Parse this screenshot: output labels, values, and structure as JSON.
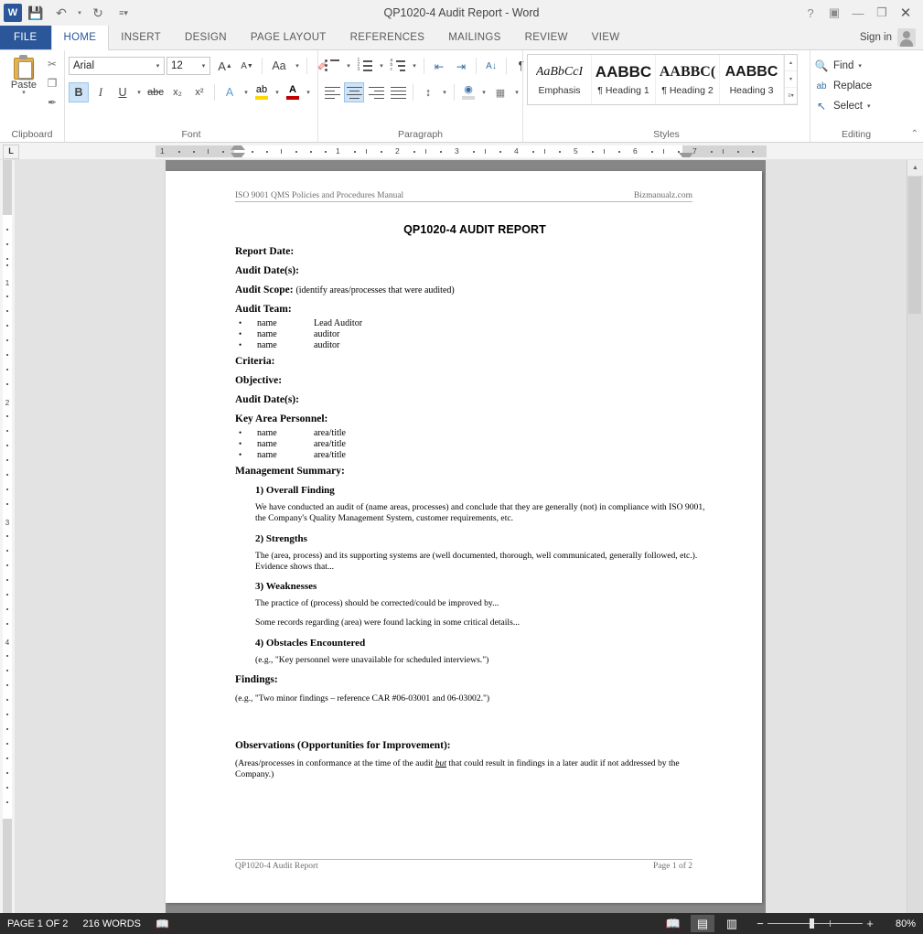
{
  "window": {
    "title": "QP1020-4 Audit Report - Word",
    "app_logo": "W",
    "quick_access": [
      {
        "name": "save-icon",
        "glyph": "💾"
      },
      {
        "name": "undo-icon",
        "glyph": "↶"
      },
      {
        "name": "undo-dropdown-icon",
        "glyph": "▾"
      },
      {
        "name": "redo-icon",
        "glyph": "↻"
      },
      {
        "name": "customize-qat-icon",
        "glyph": "≡▾"
      }
    ],
    "controls": [
      {
        "name": "help-button",
        "glyph": "?"
      },
      {
        "name": "ribbon-display-options-button",
        "glyph": "▣"
      },
      {
        "name": "minimize-button",
        "glyph": "—"
      },
      {
        "name": "restore-button",
        "glyph": "❐"
      },
      {
        "name": "close-button",
        "glyph": "✕"
      }
    ],
    "sign_in": "Sign in"
  },
  "ribbon": {
    "tabs": [
      {
        "label": "FILE",
        "state": "file"
      },
      {
        "label": "HOME",
        "state": "active"
      },
      {
        "label": "INSERT",
        "state": "normal"
      },
      {
        "label": "DESIGN",
        "state": "normal"
      },
      {
        "label": "PAGE LAYOUT",
        "state": "normal"
      },
      {
        "label": "REFERENCES",
        "state": "normal"
      },
      {
        "label": "MAILINGS",
        "state": "normal"
      },
      {
        "label": "REVIEW",
        "state": "normal"
      },
      {
        "label": "VIEW",
        "state": "normal"
      }
    ],
    "collapse_ribbon_glyph": "⌃",
    "clipboard": {
      "label": "Clipboard",
      "paste_label": "Paste",
      "paste_arrow": "▾",
      "cut_glyph": "✂",
      "copy_glyph": "❐",
      "format_painter_glyph": "✒",
      "launcher_glyph": "⤷"
    },
    "font": {
      "label": "Font",
      "font_name": "Arial",
      "font_size": "12",
      "grow_font": "A",
      "shrink_font": "A",
      "change_case": "Aa",
      "clear_formatting": "✐",
      "bold": "B",
      "italic": "I",
      "underline": "U",
      "strikethrough": "abc",
      "subscript": "x₂",
      "superscript": "x²",
      "text_effects": "A",
      "highlight": "ab",
      "font_color": "A",
      "font_color_hex": "#c00000",
      "highlight_color_hex": "#ffd800",
      "launcher_glyph": "⤷",
      "bold_active": true
    },
    "paragraph": {
      "label": "Paragraph",
      "bullets": "bullet-list-icon",
      "numbering": "numbered-list-icon",
      "multilevel": "multilevel-list-icon",
      "decrease_indent": "⇤",
      "increase_indent": "⇥",
      "sort": "A↓",
      "show_marks": "¶",
      "align_left": "align-left-icon",
      "align_center": "align-center-icon",
      "align_right": "align-right-icon",
      "justify": "justify-icon",
      "line_spacing": "↕",
      "shading": "shading-icon",
      "borders": "borders-icon",
      "launcher_glyph": "⤷",
      "align_center_active": true
    },
    "styles": {
      "label": "Styles",
      "launcher_glyph": "⤷",
      "items": [
        {
          "preview": "AaBbCcI",
          "name": "Emphasis",
          "kind": "emph"
        },
        {
          "preview": "AABBC",
          "name": "¶ Heading 1",
          "kind": "h1"
        },
        {
          "preview": "AABBC(",
          "name": "¶ Heading 2",
          "kind": "h2"
        },
        {
          "preview": "AABBC",
          "name": "Heading 3",
          "kind": "h3"
        }
      ],
      "scroll_up": "▴",
      "scroll_down": "▾",
      "more": "▾"
    },
    "editing": {
      "label": "Editing",
      "find": "Find",
      "find_arrow": "▾",
      "replace": "Replace",
      "select": "Select",
      "select_arrow": "▾",
      "find_icon": "🔍",
      "replace_icon": "ab",
      "select_icon": "↖"
    }
  },
  "ruler": {
    "tab_selector": "L",
    "h_marks": [
      "1",
      "1",
      "2",
      "3",
      "4",
      "5",
      "6",
      "7"
    ],
    "v_marks": [
      "1",
      "2",
      "3",
      "4"
    ]
  },
  "document": {
    "header": {
      "left": "ISO 9001 QMS Policies and Procedures Manual",
      "right": "Bizmanualz.com"
    },
    "footer": {
      "left": "QP1020-4 Audit Report",
      "right": "Page 1 of 2"
    },
    "title": "QP1020-4 AUDIT REPORT",
    "fields": [
      {
        "label": "Report Date:",
        "value": ""
      },
      {
        "label": "Audit Date(s):",
        "value": ""
      },
      {
        "label": "Audit Scope:",
        "value": "(identify areas/processes that were audited)"
      }
    ],
    "audit_team": {
      "label": "Audit Team:",
      "rows": [
        {
          "bullet": "•",
          "name": "name",
          "role": "Lead Auditor"
        },
        {
          "bullet": "•",
          "name": "name",
          "role": "auditor"
        },
        {
          "bullet": "•",
          "name": "name",
          "role": "auditor"
        }
      ]
    },
    "fields2": [
      {
        "label": "Criteria:"
      },
      {
        "label": "Objective:"
      },
      {
        "label": "Audit Date(s):"
      }
    ],
    "key_area_personnel": {
      "label": "Key Area Personnel:",
      "rows": [
        {
          "bullet": "•",
          "name": "name",
          "role": "area/title"
        },
        {
          "bullet": "•",
          "name": "name",
          "role": "area/title"
        },
        {
          "bullet": "•",
          "name": "name",
          "role": "area/title"
        }
      ]
    },
    "management_summary": {
      "label": "Management Summary:",
      "sections": [
        {
          "heading": "1) Overall Finding",
          "paras": [
            "We have conducted an audit of (name areas, processes) and conclude that they are generally (not) in compliance with ISO 9001, the Company's Quality Management System, customer requirements, etc."
          ]
        },
        {
          "heading": "2) Strengths",
          "paras": [
            "The (area, process) and its supporting systems are (well documented, thorough, well communicated, generally followed, etc.).  Evidence shows that..."
          ]
        },
        {
          "heading": "3) Weaknesses",
          "paras": [
            "The practice of (process) should be corrected/could be improved by...",
            "Some records regarding (area) were found lacking in some critical details..."
          ]
        },
        {
          "heading": "4) Obstacles Encountered",
          "paras": [
            "(e.g., \"Key personnel were unavailable for scheduled interviews.\")"
          ]
        }
      ]
    },
    "findings": {
      "label": "Findings:",
      "text": "(e.g., \"Two minor findings – reference CAR #06-03001 and 06-03002.\")"
    },
    "observations": {
      "label": "Observations (Opportunities for Improvement):",
      "text_before": "(Areas/processes in conformance at the time of the audit ",
      "emphasis": "but",
      "text_after": " that could result in findings in a later audit if not addressed by the Company.)"
    }
  },
  "status_bar": {
    "page_info": "PAGE 1 OF 2",
    "word_count": "216 WORDS",
    "proofing_icon": "📖",
    "views": [
      {
        "name": "read-mode",
        "glyph": "📖",
        "active": false
      },
      {
        "name": "print-layout",
        "glyph": "▤",
        "active": true
      },
      {
        "name": "web-layout",
        "glyph": "▥",
        "active": false
      }
    ],
    "zoom_out": "−",
    "zoom_in": "+",
    "zoom_level": "80%"
  }
}
